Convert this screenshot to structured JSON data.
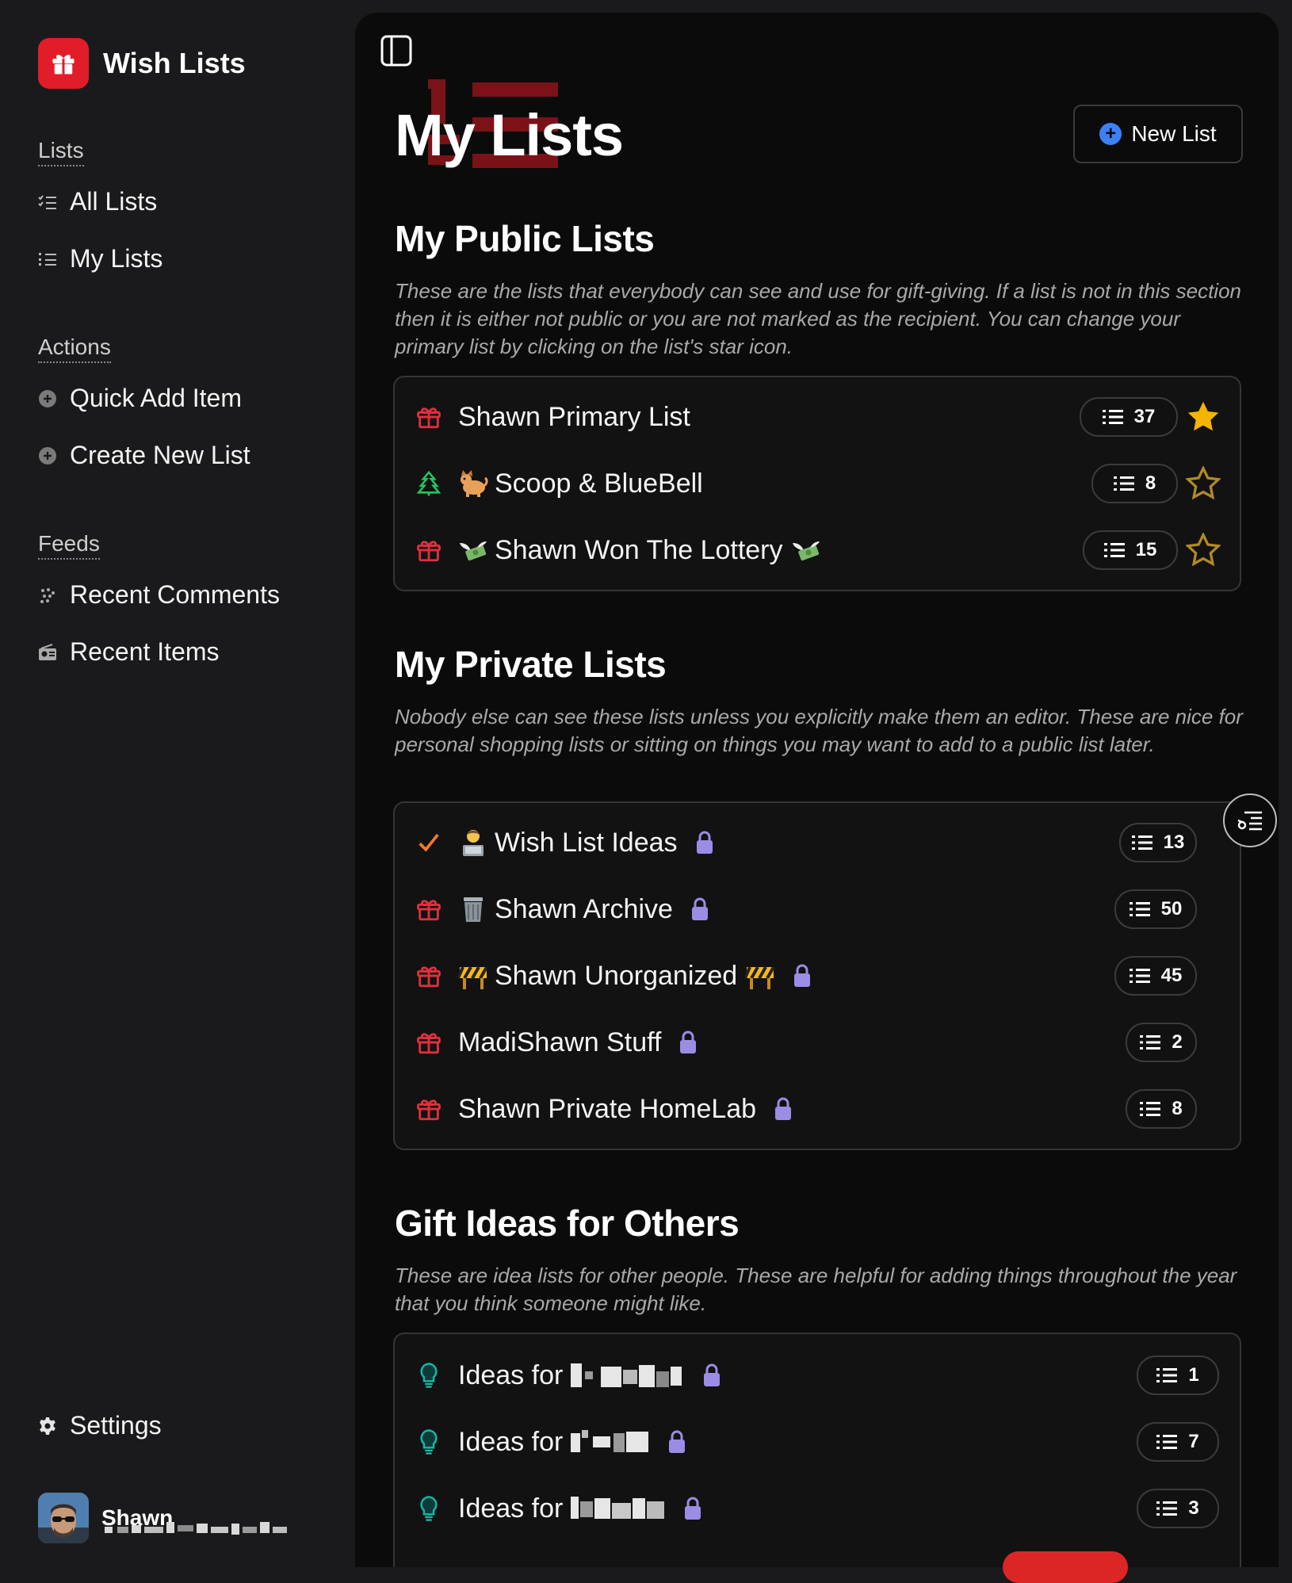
{
  "app": {
    "name": "Wish Lists"
  },
  "sidebar": {
    "groups": [
      {
        "title": "Lists",
        "items": [
          {
            "label": "All Lists",
            "icon": "checklist-icon"
          },
          {
            "label": "My Lists",
            "icon": "numbered-list-icon"
          }
        ]
      },
      {
        "title": "Actions",
        "items": [
          {
            "label": "Quick Add Item",
            "icon": "plus-circle-icon"
          },
          {
            "label": "Create New List",
            "icon": "plus-circle-icon"
          }
        ]
      },
      {
        "title": "Feeds",
        "items": [
          {
            "label": "Recent Comments",
            "icon": "comments-icon"
          },
          {
            "label": "Recent Items",
            "icon": "radio-icon"
          }
        ]
      }
    ],
    "settings_label": "Settings",
    "user": {
      "name": "Shawn"
    }
  },
  "page": {
    "title": "My Lists",
    "new_list_label": "New List"
  },
  "sections": {
    "public": {
      "title": "My Public Lists",
      "description": "These are the lists that everybody can see and use for gift-giving. If a list is not in this section then it is either not public or you are not marked as the recipient. You can change your primary list by clicking on the list's star icon.",
      "rows": [
        {
          "name": "Shawn Primary List",
          "count": "37",
          "starred": true
        },
        {
          "name": "Scoop & BlueBell",
          "count": "8",
          "starred": false
        },
        {
          "name": "Shawn Won The Lottery",
          "count": "15",
          "starred": false
        }
      ]
    },
    "private": {
      "title": "My Private Lists",
      "description": "Nobody else can see these lists unless you explicitly make them an editor. These are nice for personal shopping lists or sitting on things you may want to add to a public list later.",
      "rows": [
        {
          "name": "Wish List Ideas",
          "count": "13"
        },
        {
          "name": "Shawn Archive",
          "count": "50"
        },
        {
          "name": "Shawn Unorganized",
          "count": "45"
        },
        {
          "name": "MadiShawn Stuff",
          "count": "2"
        },
        {
          "name": "Shawn Private HomeLab",
          "count": "8"
        }
      ]
    },
    "ideas": {
      "title": "Gift Ideas for Others",
      "description": "These are idea lists for other people. These are helpful for adding things throughout the year that you think someone might like.",
      "rows": [
        {
          "name": "Ideas for",
          "count": "1"
        },
        {
          "name": "Ideas for",
          "count": "7"
        },
        {
          "name": "Ideas for",
          "count": "3"
        }
      ]
    }
  },
  "colors": {
    "brand": "#e11d2a",
    "accent": "#3b82f6",
    "star": "#f5b400",
    "lock": "#9b8ce6",
    "bulb": "#14b8a6"
  }
}
